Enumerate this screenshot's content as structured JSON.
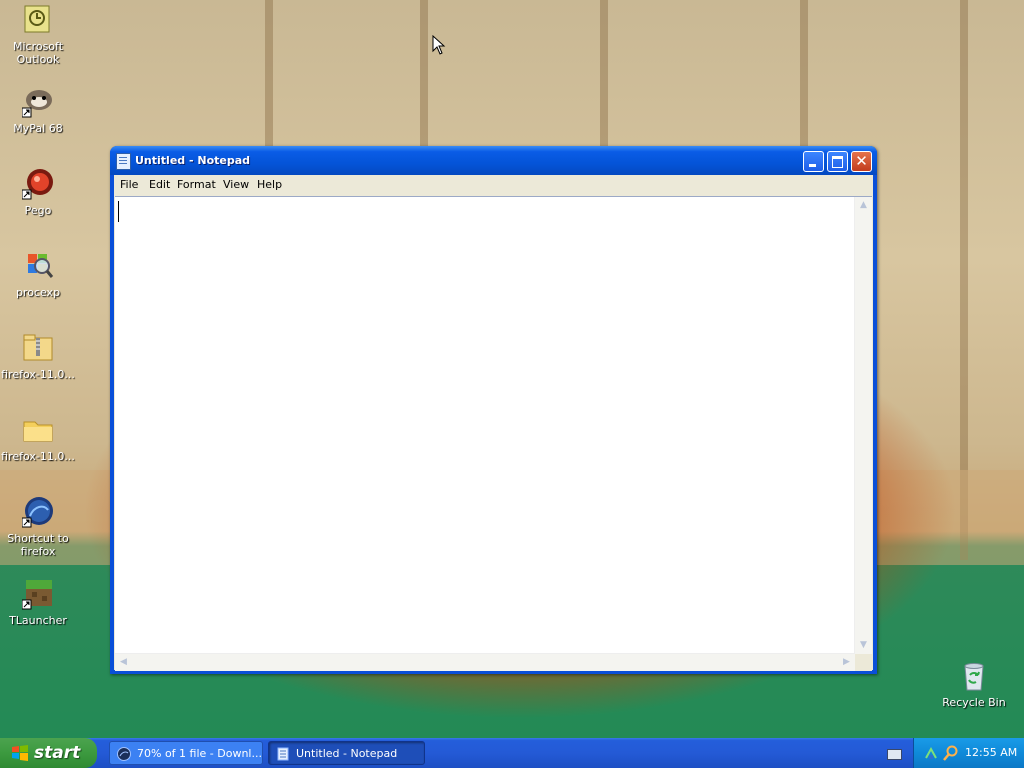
{
  "desktop": {
    "icons": [
      {
        "label": "Microsoft Outlook",
        "icon": "outlook-icon"
      },
      {
        "label": "MyPal 68",
        "icon": "mypal-icon"
      },
      {
        "label": "Pego",
        "icon": "pego-icon"
      },
      {
        "label": "procexp",
        "icon": "procexp-icon"
      },
      {
        "label": "firefox-11.0...",
        "icon": "zip-folder-icon"
      },
      {
        "label": "firefox-11.0...",
        "icon": "folder-icon"
      },
      {
        "label": "Shortcut to firefox",
        "icon": "firefox-icon"
      },
      {
        "label": "TLauncher",
        "icon": "tlauncher-icon"
      },
      {
        "label": "Recycle Bin",
        "icon": "recycle-bin-icon"
      }
    ]
  },
  "notepad": {
    "title": "Untitled - Notepad",
    "menu": [
      "File",
      "Edit",
      "Format",
      "View",
      "Help"
    ],
    "content": "",
    "close_glyph": "✕"
  },
  "taskbar": {
    "start_label": "start",
    "tasks": [
      {
        "label": "70% of 1 file - Downl...",
        "icon": "download-icon",
        "active": false
      },
      {
        "label": "Untitled - Notepad",
        "icon": "notepad-icon",
        "active": true
      }
    ],
    "clock": "12:55 AM",
    "tray_icons": [
      "keyboard-icon",
      "network-icon",
      "search-icon"
    ]
  },
  "colors": {
    "title_bar": "#0454d8",
    "taskbar": "#245edb",
    "start_button": "#3c9a3f",
    "tray": "#0f8ad9"
  }
}
